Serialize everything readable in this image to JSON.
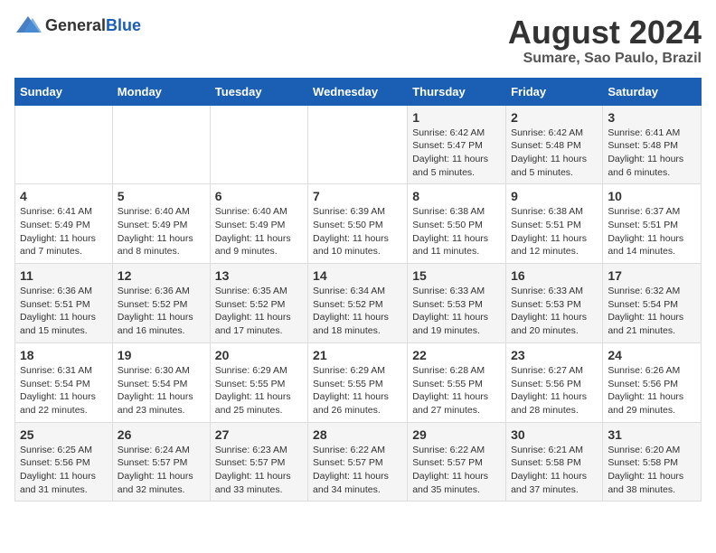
{
  "header": {
    "logo_general": "General",
    "logo_blue": "Blue",
    "title": "August 2024",
    "subtitle": "Sumare, Sao Paulo, Brazil"
  },
  "days_of_week": [
    "Sunday",
    "Monday",
    "Tuesday",
    "Wednesday",
    "Thursday",
    "Friday",
    "Saturday"
  ],
  "weeks": [
    [
      {
        "day": "",
        "sunrise": "",
        "sunset": "",
        "daylight": ""
      },
      {
        "day": "",
        "sunrise": "",
        "sunset": "",
        "daylight": ""
      },
      {
        "day": "",
        "sunrise": "",
        "sunset": "",
        "daylight": ""
      },
      {
        "day": "",
        "sunrise": "",
        "sunset": "",
        "daylight": ""
      },
      {
        "day": "1",
        "sunrise": "6:42 AM",
        "sunset": "5:47 PM",
        "daylight": "11 hours and 5 minutes."
      },
      {
        "day": "2",
        "sunrise": "6:42 AM",
        "sunset": "5:48 PM",
        "daylight": "11 hours and 5 minutes."
      },
      {
        "day": "3",
        "sunrise": "6:41 AM",
        "sunset": "5:48 PM",
        "daylight": "11 hours and 6 minutes."
      }
    ],
    [
      {
        "day": "4",
        "sunrise": "6:41 AM",
        "sunset": "5:49 PM",
        "daylight": "11 hours and 7 minutes."
      },
      {
        "day": "5",
        "sunrise": "6:40 AM",
        "sunset": "5:49 PM",
        "daylight": "11 hours and 8 minutes."
      },
      {
        "day": "6",
        "sunrise": "6:40 AM",
        "sunset": "5:49 PM",
        "daylight": "11 hours and 9 minutes."
      },
      {
        "day": "7",
        "sunrise": "6:39 AM",
        "sunset": "5:50 PM",
        "daylight": "11 hours and 10 minutes."
      },
      {
        "day": "8",
        "sunrise": "6:38 AM",
        "sunset": "5:50 PM",
        "daylight": "11 hours and 11 minutes."
      },
      {
        "day": "9",
        "sunrise": "6:38 AM",
        "sunset": "5:51 PM",
        "daylight": "11 hours and 12 minutes."
      },
      {
        "day": "10",
        "sunrise": "6:37 AM",
        "sunset": "5:51 PM",
        "daylight": "11 hours and 14 minutes."
      }
    ],
    [
      {
        "day": "11",
        "sunrise": "6:36 AM",
        "sunset": "5:51 PM",
        "daylight": "11 hours and 15 minutes."
      },
      {
        "day": "12",
        "sunrise": "6:36 AM",
        "sunset": "5:52 PM",
        "daylight": "11 hours and 16 minutes."
      },
      {
        "day": "13",
        "sunrise": "6:35 AM",
        "sunset": "5:52 PM",
        "daylight": "11 hours and 17 minutes."
      },
      {
        "day": "14",
        "sunrise": "6:34 AM",
        "sunset": "5:52 PM",
        "daylight": "11 hours and 18 minutes."
      },
      {
        "day": "15",
        "sunrise": "6:33 AM",
        "sunset": "5:53 PM",
        "daylight": "11 hours and 19 minutes."
      },
      {
        "day": "16",
        "sunrise": "6:33 AM",
        "sunset": "5:53 PM",
        "daylight": "11 hours and 20 minutes."
      },
      {
        "day": "17",
        "sunrise": "6:32 AM",
        "sunset": "5:54 PM",
        "daylight": "11 hours and 21 minutes."
      }
    ],
    [
      {
        "day": "18",
        "sunrise": "6:31 AM",
        "sunset": "5:54 PM",
        "daylight": "11 hours and 22 minutes."
      },
      {
        "day": "19",
        "sunrise": "6:30 AM",
        "sunset": "5:54 PM",
        "daylight": "11 hours and 23 minutes."
      },
      {
        "day": "20",
        "sunrise": "6:29 AM",
        "sunset": "5:55 PM",
        "daylight": "11 hours and 25 minutes."
      },
      {
        "day": "21",
        "sunrise": "6:29 AM",
        "sunset": "5:55 PM",
        "daylight": "11 hours and 26 minutes."
      },
      {
        "day": "22",
        "sunrise": "6:28 AM",
        "sunset": "5:55 PM",
        "daylight": "11 hours and 27 minutes."
      },
      {
        "day": "23",
        "sunrise": "6:27 AM",
        "sunset": "5:56 PM",
        "daylight": "11 hours and 28 minutes."
      },
      {
        "day": "24",
        "sunrise": "6:26 AM",
        "sunset": "5:56 PM",
        "daylight": "11 hours and 29 minutes."
      }
    ],
    [
      {
        "day": "25",
        "sunrise": "6:25 AM",
        "sunset": "5:56 PM",
        "daylight": "11 hours and 31 minutes."
      },
      {
        "day": "26",
        "sunrise": "6:24 AM",
        "sunset": "5:57 PM",
        "daylight": "11 hours and 32 minutes."
      },
      {
        "day": "27",
        "sunrise": "6:23 AM",
        "sunset": "5:57 PM",
        "daylight": "11 hours and 33 minutes."
      },
      {
        "day": "28",
        "sunrise": "6:22 AM",
        "sunset": "5:57 PM",
        "daylight": "11 hours and 34 minutes."
      },
      {
        "day": "29",
        "sunrise": "6:22 AM",
        "sunset": "5:57 PM",
        "daylight": "11 hours and 35 minutes."
      },
      {
        "day": "30",
        "sunrise": "6:21 AM",
        "sunset": "5:58 PM",
        "daylight": "11 hours and 37 minutes."
      },
      {
        "day": "31",
        "sunrise": "6:20 AM",
        "sunset": "5:58 PM",
        "daylight": "11 hours and 38 minutes."
      }
    ]
  ],
  "labels": {
    "sunrise_prefix": "Sunrise: ",
    "sunset_prefix": "Sunset: ",
    "daylight_prefix": "Daylight: "
  }
}
